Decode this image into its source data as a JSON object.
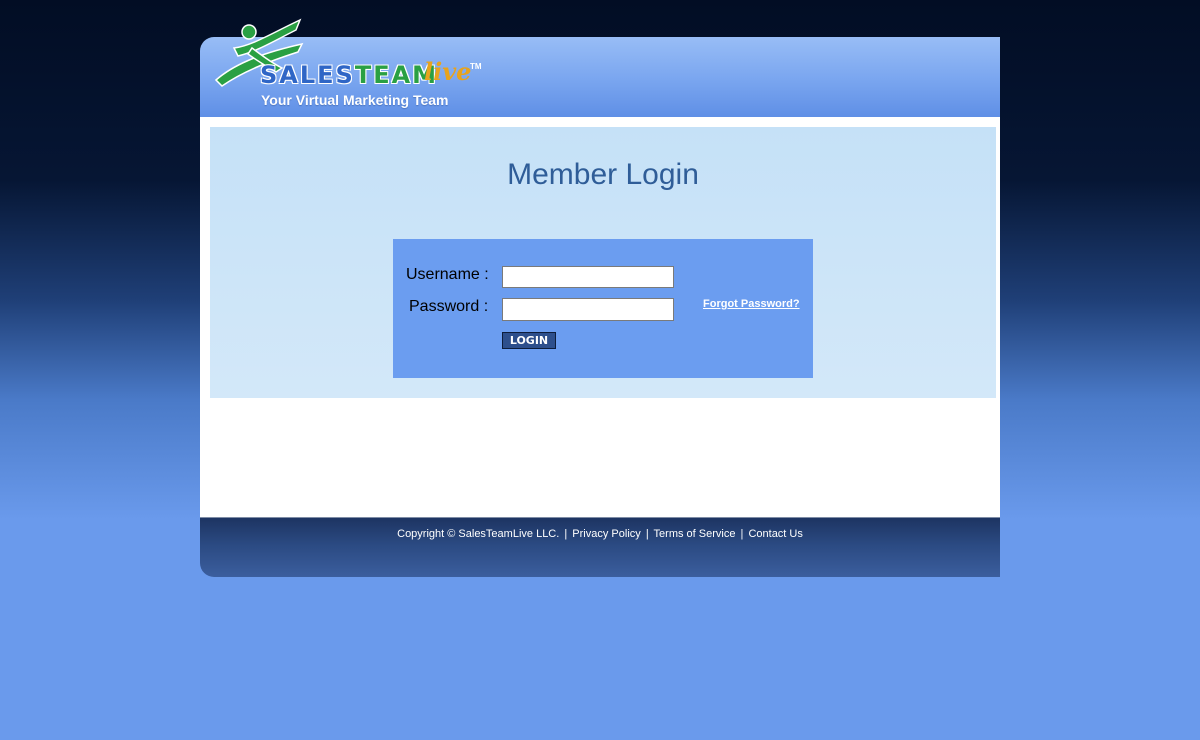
{
  "logo": {
    "brand_sales": "SALES",
    "brand_team": "TEAM",
    "brand_live": "live",
    "trademark": "TM",
    "tagline": "Your Virtual Marketing Team",
    "icon": "running-person-icon",
    "colors": {
      "sales": "#2f66c6",
      "team": "#2aa043",
      "live": "#e7a31d",
      "figure": "#2aa043"
    }
  },
  "login": {
    "title": "Member Login",
    "username_label": "Username :",
    "username_value": "",
    "password_label": "Password :",
    "password_value": "",
    "forgot_link": "Forgot Password?",
    "login_button": "LOGIN"
  },
  "footer": {
    "copyright": "Copyright © SalesTeamLive LLC.",
    "separator": "|",
    "links": [
      "Privacy Policy",
      "Terms of Service",
      "Contact Us"
    ]
  },
  "colors": {
    "header_blue": "#79a5ef",
    "panel_light_blue": "#c5e1f7",
    "login_box_blue": "#6b9df0",
    "title_text": "#2f5d98",
    "footer_navy": "#2b4a82",
    "background_bottom": "#6a9aec"
  }
}
